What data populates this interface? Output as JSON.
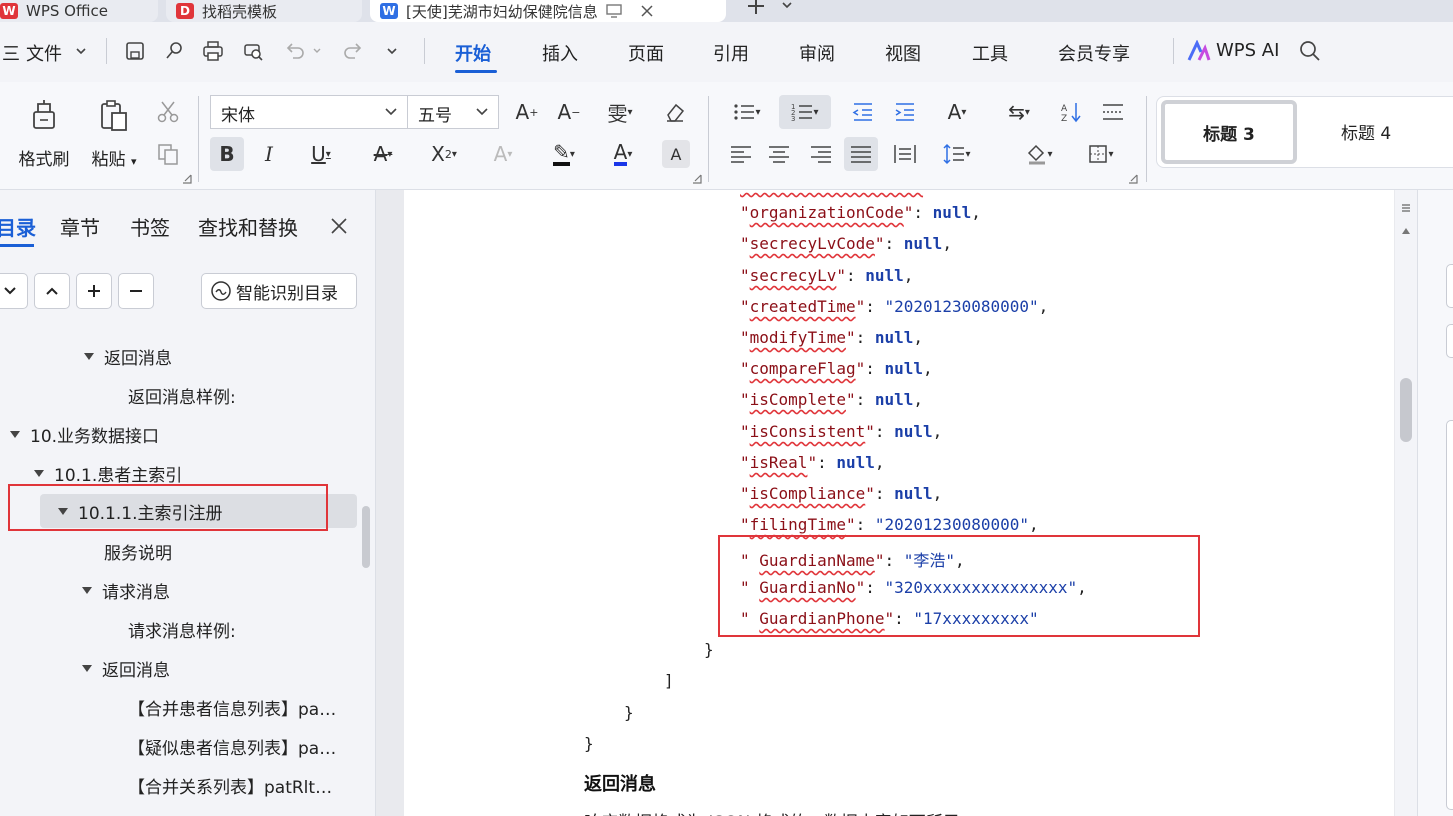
{
  "tabs": [
    {
      "label": "WPS Office",
      "logo": "W",
      "color": "#e0353a"
    },
    {
      "label": "找稻壳模板",
      "logo": "D",
      "color": "#e0353a"
    },
    {
      "label": "[天使]芜湖市妇幼保健院信息",
      "logo": "W",
      "color": "#2f6fe4"
    }
  ],
  "menu": {
    "hamburger": "三",
    "file": "文件",
    "items": [
      "开始",
      "插入",
      "页面",
      "引用",
      "审阅",
      "视图",
      "工具",
      "会员专享"
    ],
    "wps_ai": "WPS AI"
  },
  "ribbon": {
    "format_painter": "格式刷",
    "paste": "粘贴",
    "font_name": "宋体",
    "font_size": "五号",
    "styles": [
      "标题 3",
      "标题 4"
    ]
  },
  "leftpanel": {
    "tabs": [
      "目录",
      "章节",
      "书签",
      "查找和替换"
    ],
    "smart_btn": "智能识别目录",
    "toc": [
      {
        "label": "返回消息",
        "arrow": true
      },
      {
        "label": "返回消息样例:",
        "arrow": false
      },
      {
        "label": "10.业务数据接口",
        "arrow": true
      },
      {
        "label": "10.1.患者主索引",
        "arrow": true
      },
      {
        "label": "10.1.1.主索引注册",
        "arrow": true
      },
      {
        "label": "服务说明",
        "arrow": false
      },
      {
        "label": "请求消息",
        "arrow": true
      },
      {
        "label": "请求消息样例:",
        "arrow": false
      },
      {
        "label": "返回消息",
        "arrow": true
      },
      {
        "label": "【合并患者信息列表】pa…",
        "arrow": false
      },
      {
        "label": "【疑似患者信息列表】pa…",
        "arrow": false
      },
      {
        "label": "【合并关系列表】patRlt…",
        "arrow": false
      }
    ]
  },
  "document": {
    "fields": [
      {
        "q": "\"",
        "key": "organizationCode",
        "val": "null",
        "type": "n",
        "comma": ","
      },
      {
        "q": "\"",
        "key": "secrecyLvCode",
        "val": "null",
        "type": "n",
        "comma": ","
      },
      {
        "q": "\"",
        "key": "secrecyLv",
        "val": "null",
        "type": "n",
        "comma": ","
      },
      {
        "q": "\"",
        "key": "createdTime",
        "val": "\"20201230080000\"",
        "type": "s",
        "comma": ","
      },
      {
        "q": "\"",
        "key": "modifyTime",
        "val": "null",
        "type": "n",
        "comma": ","
      },
      {
        "q": "\"",
        "key": "compareFlag",
        "val": "null",
        "type": "n",
        "comma": ","
      },
      {
        "q": "\"",
        "key": "isComplete",
        "val": "null",
        "type": "n",
        "comma": ","
      },
      {
        "q": "\"",
        "key": "isConsistent",
        "val": "null",
        "type": "n",
        "comma": ","
      },
      {
        "q": "\"",
        "key": "isReal",
        "val": "null",
        "type": "n",
        "comma": ","
      },
      {
        "q": "\"",
        "key": "isCompliance",
        "val": "null",
        "type": "n",
        "comma": ","
      },
      {
        "q": "\"",
        "key": "filingTime",
        "val": "\"20201230080000\"",
        "type": "s",
        "comma": ","
      },
      {
        "q": "\" ",
        "key": "GuardianName",
        "val": "\"李浩\"",
        "type": "s",
        "comma": ","
      },
      {
        "q": "\" ",
        "key": "GuardianNo",
        "val": "\"320xxxxxxxxxxxxxxx\"",
        "type": "s",
        "comma": ","
      },
      {
        "q": "\" ",
        "key": "GuardianPhone",
        "val": "\"17xxxxxxxxx\"",
        "type": "s",
        "comma": ""
      }
    ],
    "closers": [
      "}",
      "]",
      "}",
      "}"
    ],
    "heading": "返回消息",
    "partial_text": "响应数据格式为 JSON 格式的，数据内容如下所示："
  }
}
